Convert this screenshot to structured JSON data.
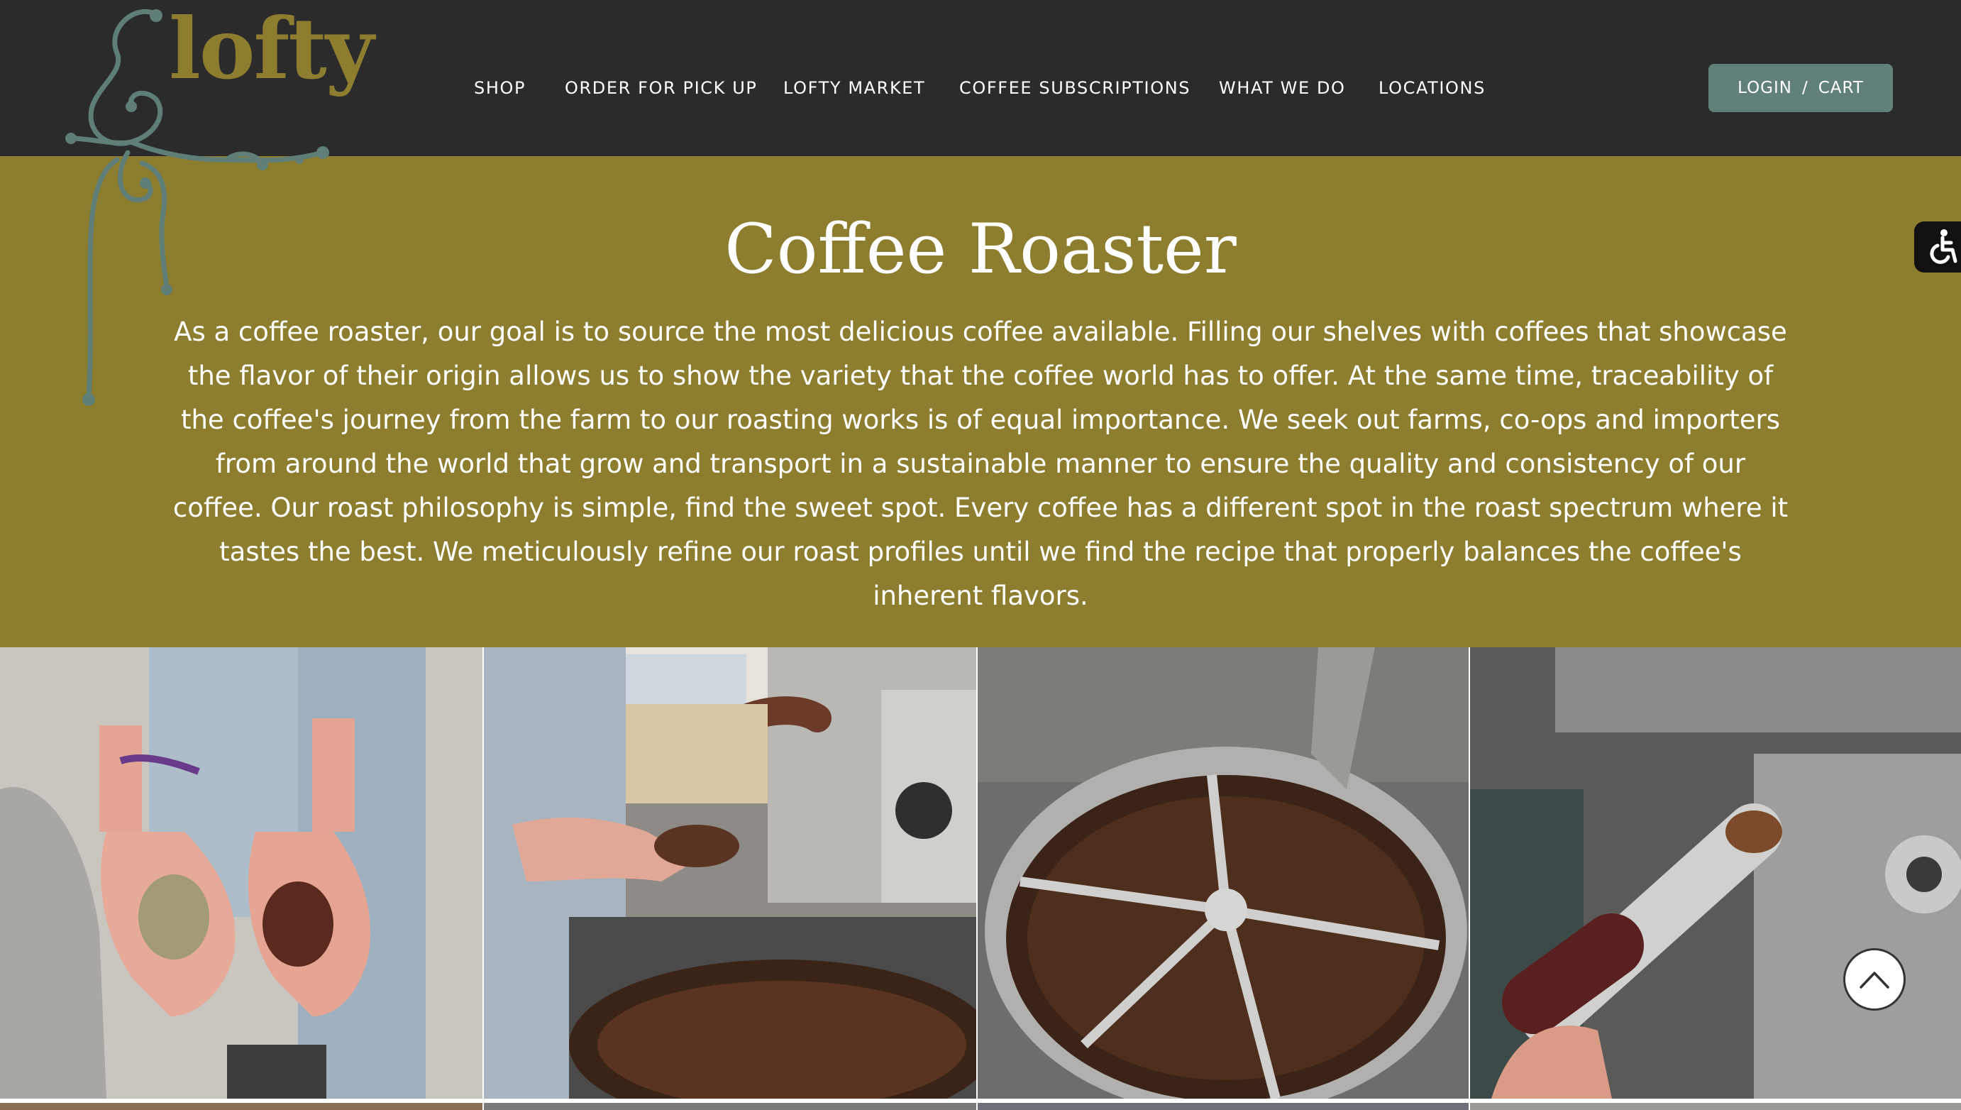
{
  "brand": {
    "logo_text": "lofty",
    "logo_color": "#8d7d2f",
    "swirl_color": "#5f7e78"
  },
  "nav": {
    "items": [
      {
        "label": "SHOP"
      },
      {
        "label": "ORDER FOR PICK UP"
      },
      {
        "label": "LOFTY MARKET"
      },
      {
        "label": "COFFEE SUBSCRIPTIONS"
      },
      {
        "label": "WHAT WE DO"
      },
      {
        "label": "LOCATIONS"
      }
    ],
    "login_label": "LOGIN",
    "separator": "/",
    "cart_label": "CART"
  },
  "hero": {
    "title": "Coffee Roaster",
    "body": "As a coffee roaster, our goal is to source the most delicious coffee available. Filling our shelves with coffees that showcase the flavor of their origin allows us to show the variety that the coffee world has to offer. At the same time, traceability of the coffee's journey from the farm to our roasting works is of equal importance. We seek out farms, co-ops and importers from around the world that grow and transport in a sustainable manner to ensure the quality and consistency of our coffee. Our roast philosophy is simple, find the sweet spot. Every coffee has a different spot in the roast spectrum where it tastes the best. We meticulously refine our roast profiles until we find the recipe that properly balances the coffee's inherent flavors."
  },
  "gallery": {
    "images": [
      {
        "subject": "hands holding green and roasted coffee beans"
      },
      {
        "subject": "roaster sampling beans from a roasting machine"
      },
      {
        "subject": "roasted beans in the cooling tray"
      },
      {
        "subject": "bean trier pulled from the roaster"
      }
    ]
  },
  "controls": {
    "accessibility_icon": "accessibility-icon",
    "scroll_top_icon": "chevron-up-icon"
  },
  "colors": {
    "header_bg": "#2b2b2b",
    "hero_bg": "#8d7d2f",
    "button_bg": "#62807a"
  }
}
